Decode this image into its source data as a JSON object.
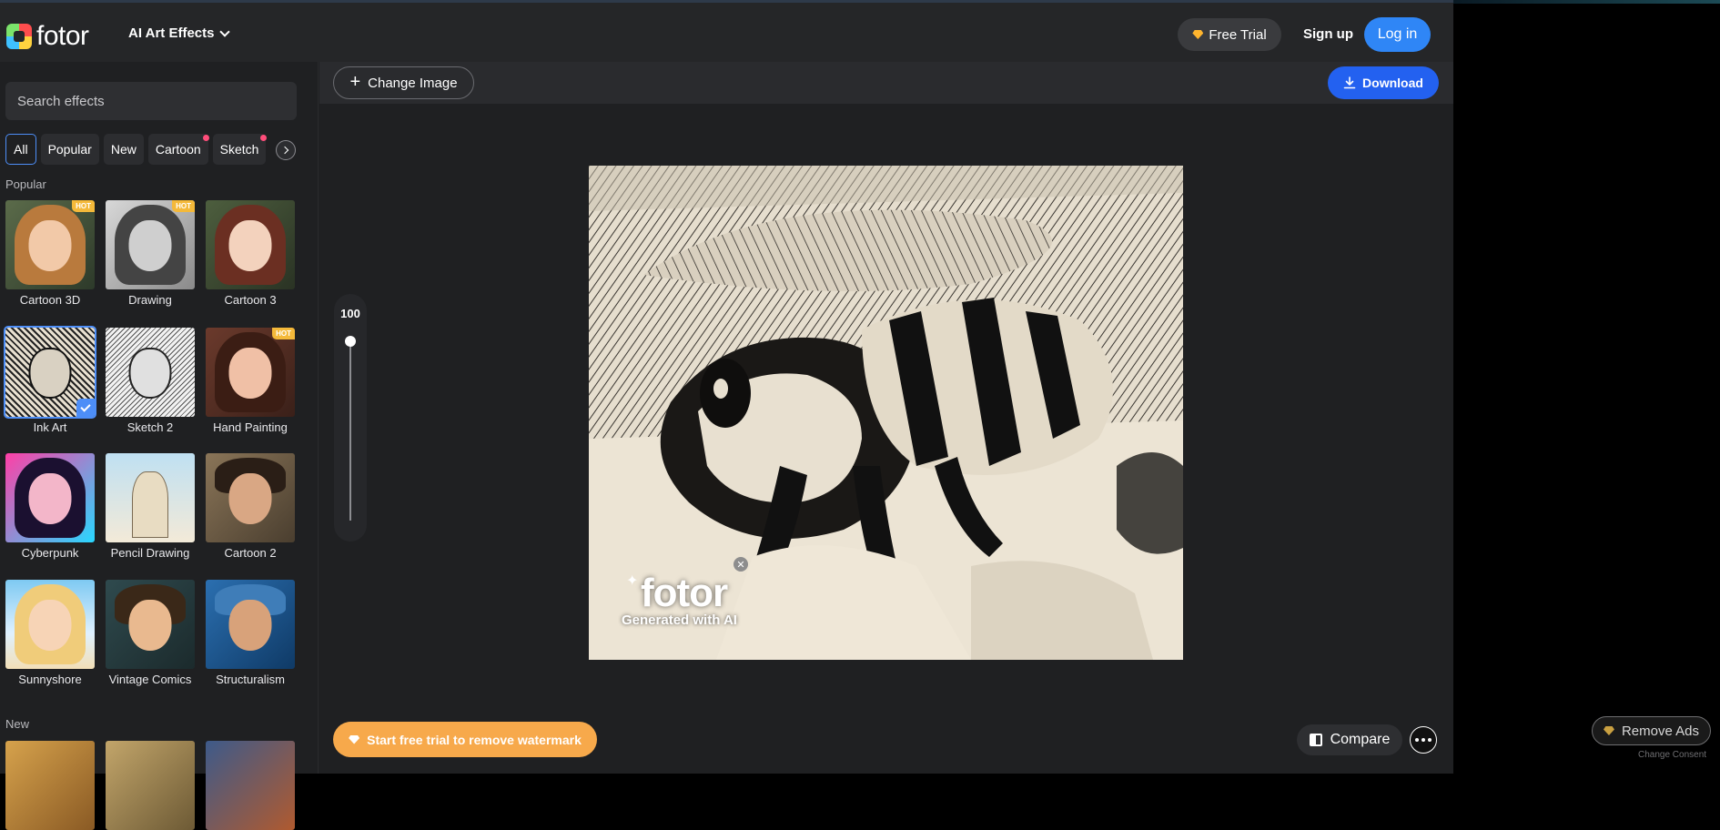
{
  "header": {
    "logo_text": "fotor",
    "menu_label": "AI Art Effects",
    "free_trial_label": "Free Trial",
    "signup_label": "Sign up",
    "login_label": "Log in"
  },
  "sidebar": {
    "search_placeholder": "Search effects",
    "chips": [
      "All",
      "Popular",
      "New",
      "Cartoon",
      "Sketch"
    ],
    "popular_label": "Popular",
    "new_label": "New",
    "effects": [
      {
        "name": "Cartoon 3D",
        "hot": "HOT"
      },
      {
        "name": "Drawing",
        "hot": "HOT"
      },
      {
        "name": "Cartoon 3"
      },
      {
        "name": "Ink Art",
        "selected": true
      },
      {
        "name": "Sketch 2"
      },
      {
        "name": "Hand Painting",
        "hot": "HOT"
      },
      {
        "name": "Cyberpunk"
      },
      {
        "name": "Pencil Drawing"
      },
      {
        "name": "Cartoon 2"
      },
      {
        "name": "Sunnyshore"
      },
      {
        "name": "Vintage Comics"
      },
      {
        "name": "Structuralism"
      }
    ]
  },
  "toolbar": {
    "change_image_label": "Change Image",
    "download_label": "Download"
  },
  "canvas": {
    "slider_value": "100",
    "watermark_logo": "fotor",
    "watermark_sub": "Generated with AI",
    "trial_label": "Start free trial to remove watermark",
    "compare_label": "Compare"
  },
  "ads": {
    "remove_ads_label": "Remove Ads",
    "consent_label": "Change Consent"
  },
  "colors": {
    "accent_blue": "#2f86f6",
    "download_blue": "#2361f0",
    "trial_orange": "#f7a94b",
    "hot_badge": "#f4b93a"
  }
}
